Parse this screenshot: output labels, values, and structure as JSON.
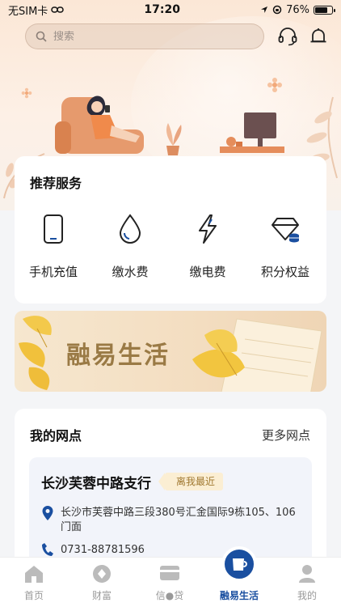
{
  "status_bar": {
    "carrier": "无SIM卡",
    "time": "17:20",
    "battery": "76%"
  },
  "header": {
    "search_placeholder": "搜索",
    "icons": [
      "customer-service-icon",
      "bell-icon"
    ]
  },
  "services": {
    "title": "推荐服务",
    "items": [
      {
        "label": "手机充值",
        "icon": "phone-icon"
      },
      {
        "label": "缴水费",
        "icon": "water-drop-icon"
      },
      {
        "label": "缴电费",
        "icon": "lightning-icon"
      },
      {
        "label": "积分权益",
        "icon": "diamond-coins-icon"
      }
    ]
  },
  "banner": {
    "title": "融易生活"
  },
  "branches": {
    "title": "我的网点",
    "more_label": "更多网点",
    "nearest": {
      "name": "长沙芙蓉中路支行",
      "badge": "离我最近",
      "address": "长沙市芙蓉中路三段380号汇金国际9栋105、106门面",
      "phone": "0731-88781596"
    }
  },
  "tab_bar": {
    "active": "融易生活",
    "tabs": [
      {
        "label": "首页",
        "icon": "home-icon"
      },
      {
        "label": "财富",
        "icon": "wealth-icon"
      },
      {
        "label": "信●贷",
        "icon": "card-icon"
      },
      {
        "label": "融易生活",
        "icon": "cup-icon"
      },
      {
        "label": "我的",
        "icon": "person-icon"
      }
    ]
  },
  "colors": {
    "accent": "#1a4fa0",
    "hero_bg": "#fbe7d6",
    "badge_bg": "#fbeed3",
    "banner_text": "#9a7a45"
  }
}
